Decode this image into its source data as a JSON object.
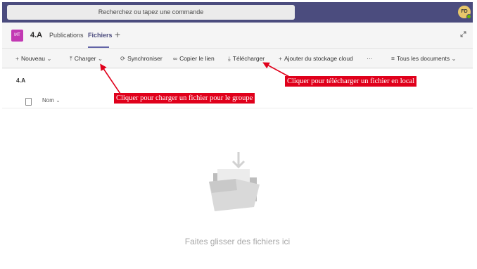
{
  "topbar": {
    "search_placeholder": "Recherchez ou tapez une commande",
    "avatar_initials": "FD"
  },
  "channel": {
    "team_initials": "MT",
    "team_name": "4.A",
    "tabs": [
      {
        "label": "Publications",
        "active": false
      },
      {
        "label": "Fichiers",
        "active": true
      }
    ],
    "add_tab": "+"
  },
  "toolbar": {
    "new_label": "Nouveau",
    "upload_label": "Charger",
    "sync_label": "Synchroniser",
    "copy_link_label": "Copier le lien",
    "download_label": "Télécharger",
    "add_storage_label": "Ajouter du stockage cloud",
    "more_label": "···",
    "view_label": "Tous les documents"
  },
  "files": {
    "folder_title": "4.A",
    "column_name": "Nom",
    "empty_message": "Faites glisser des fichiers ici"
  },
  "annotations": {
    "upload_note": "Cliquer pour charger un fichier  pour le groupe",
    "download_note": "Cliquer  pour télécharger un fichier  en local"
  },
  "colors": {
    "topbar": "#4b4c7e",
    "accent": "#6264a7",
    "team_logo": "#c239b3",
    "callout": "#e0001b"
  }
}
